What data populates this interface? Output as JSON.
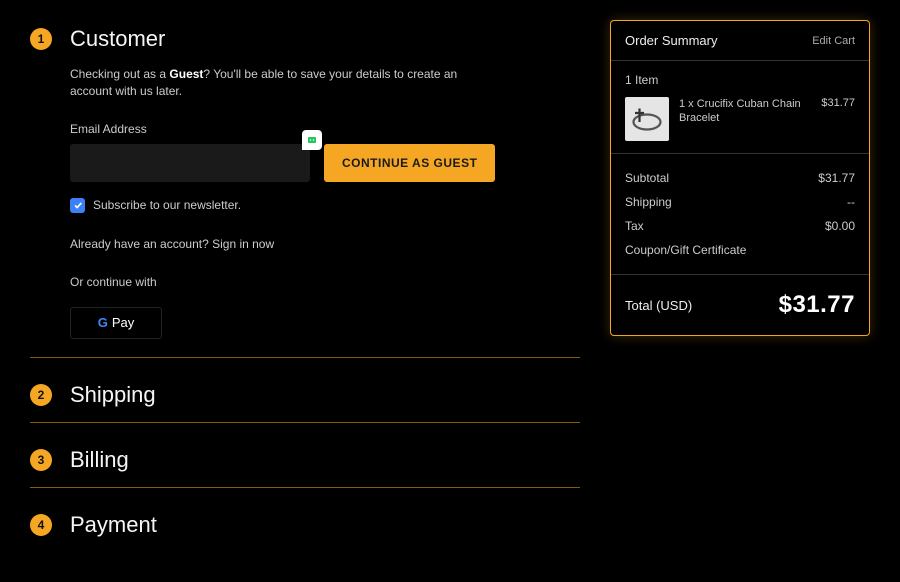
{
  "steps": {
    "customer": {
      "num": "1",
      "title": "Customer"
    },
    "shipping": {
      "num": "2",
      "title": "Shipping"
    },
    "billing": {
      "num": "3",
      "title": "Billing"
    },
    "payment": {
      "num": "4",
      "title": "Payment"
    }
  },
  "customer": {
    "guest_pre": "Checking out as a ",
    "guest_word": "Guest",
    "guest_post": "? You'll be able to save your details to create an account with us later.",
    "email_label": "Email Address",
    "continue_label": "CONTINUE AS GUEST",
    "newsletter_label": "Subscribe to our newsletter.",
    "already_pre": "Already have an account? ",
    "signin_label": "Sign in now",
    "or_continue": "Or continue with",
    "gpay_label": "Pay"
  },
  "summary": {
    "title": "Order Summary",
    "edit": "Edit Cart",
    "item_count": "1 Item",
    "item": {
      "qty_name": "1 x Crucifix Cuban Chain Bracelet",
      "price": "$31.77"
    },
    "subtotal_label": "Subtotal",
    "subtotal_value": "$31.77",
    "shipping_label": "Shipping",
    "shipping_value": "--",
    "tax_label": "Tax",
    "tax_value": "$0.00",
    "coupon_label": "Coupon/Gift Certificate",
    "total_label": "Total (USD)",
    "total_value": "$31.77"
  }
}
